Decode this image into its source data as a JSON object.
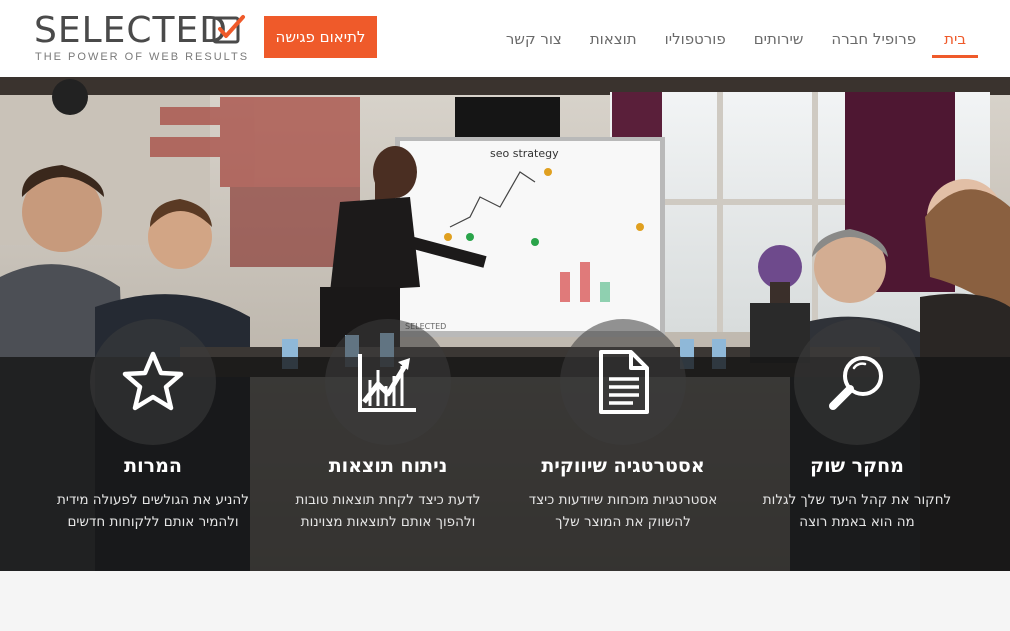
{
  "header": {
    "logo_text": "SELECTED",
    "logo_tagline": "THE POWER OF WEB RESULTS",
    "cta_label": "לתיאום פגישה",
    "nav": [
      {
        "label": "בית",
        "active": true
      },
      {
        "label": "פרופיל חברה",
        "active": false
      },
      {
        "label": "שירותים",
        "active": false
      },
      {
        "label": "פורטפוליו",
        "active": false
      },
      {
        "label": "תוצאות",
        "active": false
      },
      {
        "label": "צור קשר",
        "active": false
      }
    ]
  },
  "hero": {
    "whiteboard_title": "seo strategy",
    "whiteboard_brand": "SELECTED",
    "features": [
      {
        "icon": "magnifier-icon",
        "title": "מחקר שוק",
        "line1": "לחקור את קהל היעד שלך לגלות",
        "line2": "מה הוא באמת רוצה"
      },
      {
        "icon": "document-icon",
        "title": "אסטרטגיה שיווקית",
        "line1": "אסטרטגיות מוכחות שיודעות כיצד",
        "line2": "להשווק את המוצר שלך"
      },
      {
        "icon": "growth-chart-icon",
        "title": "ניתוח תוצאות",
        "line1": "לדעת כיצד לקחת תוצאות טובות",
        "line2": "ולהפוך אותם לתוצאות מצוינות"
      },
      {
        "icon": "star-icon",
        "title": "המרות",
        "line1": "להניע את הגולשים לפעולה מידית",
        "line2": "ולהמיר אותם ללקוחות חדשים"
      }
    ]
  },
  "colors": {
    "accent": "#ef5a2a",
    "text_dark": "#4a4a4a",
    "nav_text": "#6a6a6a"
  }
}
